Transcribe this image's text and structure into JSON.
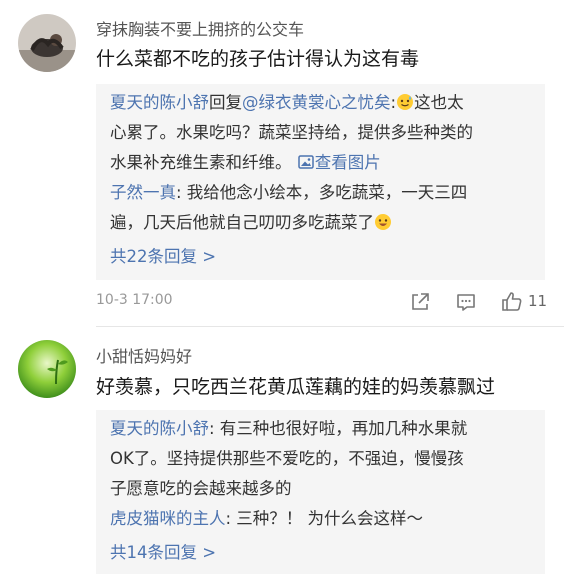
{
  "comments": [
    {
      "username": "穿抹胸装不要上拥挤的公交车",
      "text": "什么菜都不吃的孩子估计得认为这有毒",
      "replies": {
        "first": {
          "author": "夏天的陈小舒",
          "reply_word": "回复",
          "target": "@绿衣黄裳心之忧矣",
          "colon": ":",
          "line1_after_emoji": "这也太",
          "line2": "心累了。水果吃吗？蔬菜坚持给，提供多些种类的",
          "line3_text": "水果补充维生素和纤维。",
          "view_image": "查看图片"
        },
        "second": {
          "author": "子然一真",
          "line1_after_author": ": 我给他念小绘本，多吃蔬菜，一天三四",
          "line2": "遍，几天后他就自己叨叨多吃蔬菜了"
        },
        "more": "共22条回复 >"
      },
      "time": "10-3 17:00",
      "like_count": "11"
    },
    {
      "username": "小甜恬妈妈好",
      "text": "好羡慕，只吃西兰花黄瓜莲藕的娃的妈羡慕飘过",
      "replies": {
        "first": {
          "author": "夏天的陈小舒",
          "line1_after_author": ": 有三种也很好啦，再加几种水果就",
          "line2": "OK了。坚持提供那些不爱吃的，不强迫，慢慢孩",
          "line3": "子愿意吃的会越来越多的"
        },
        "second": {
          "author": "虎皮猫咪的主人",
          "line1_after_author": ": 三种？！ 为什么会这样～"
        },
        "more": "共14条回复 >"
      }
    }
  ],
  "colors": {
    "link": "#4d74b0",
    "reply_bg": "#f5f5f5",
    "time": "#999999"
  },
  "icons": [
    "share-icon",
    "comment-icon",
    "like-icon",
    "emoji-sweat-icon",
    "emoji-grin-icon",
    "image-icon"
  ]
}
